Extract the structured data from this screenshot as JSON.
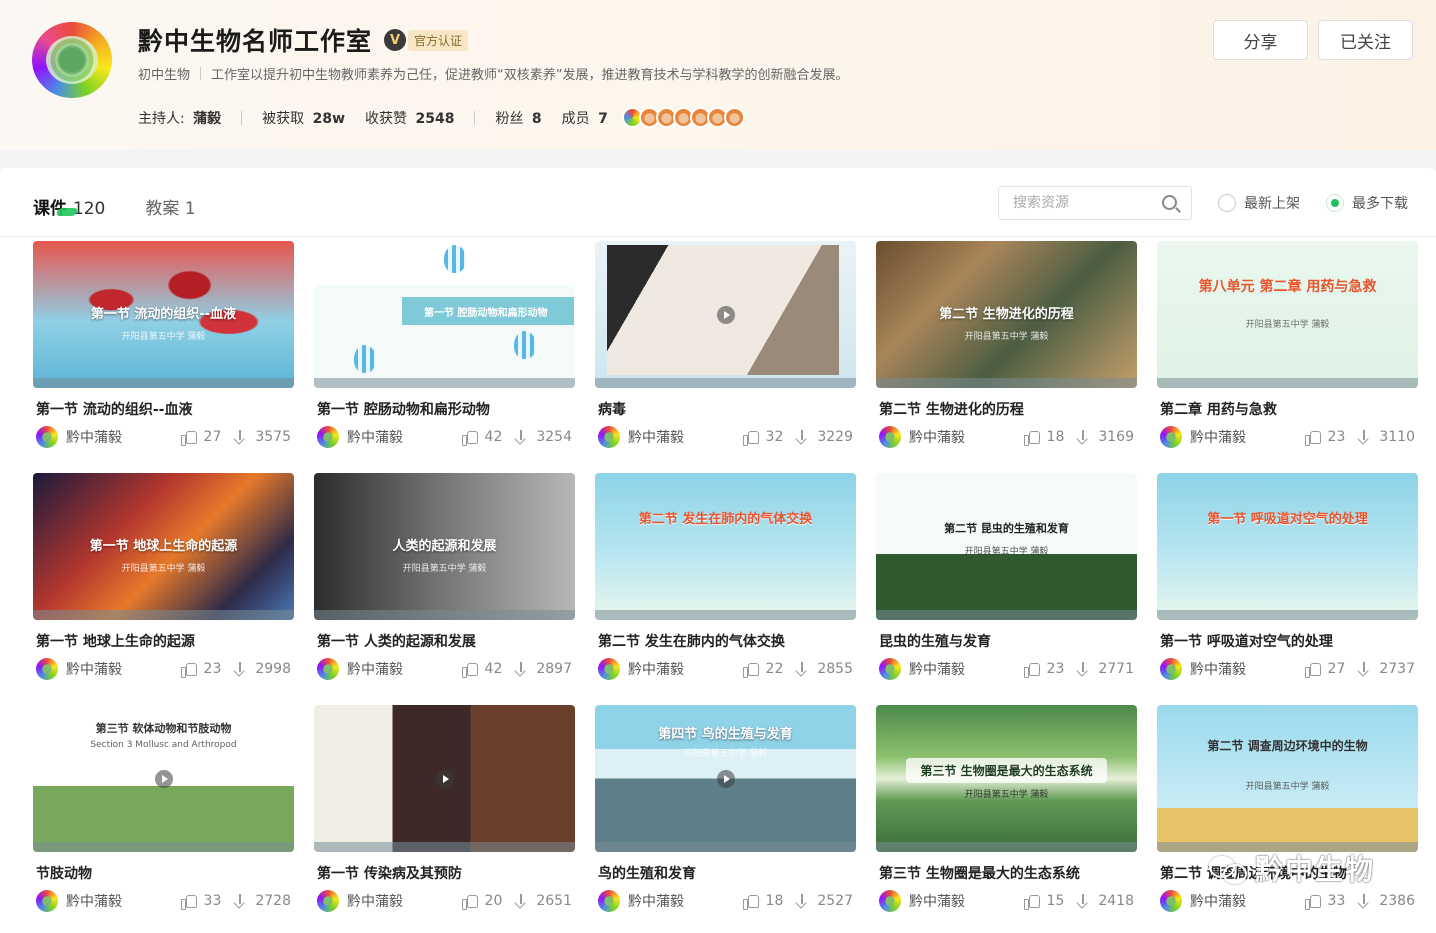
{
  "profile": {
    "title": "黔中生物名师工作室",
    "badge_letter": "V",
    "badge_text": "官方认证",
    "category": "初中生物",
    "description": "工作室以提升初中生物教师素养为己任，促进教师“双核素养”发展，推进教育技术与学科教学的创新融合发展。",
    "host_label": "主持人:",
    "host_name": "蒲毅",
    "obtained_label": "被获取",
    "obtained_value": "28w",
    "likes_label": "收获赞",
    "likes_value": "2548",
    "fans_label": "粉丝",
    "fans_value": "8",
    "members_label": "成员",
    "members_value": "7"
  },
  "actions": {
    "share": "分享",
    "follow": "已关注"
  },
  "tabs": [
    {
      "label": "课件",
      "count": "120"
    },
    {
      "label": "教案",
      "count": "1"
    }
  ],
  "search": {
    "placeholder": "搜索资源",
    "icon": "search-icon"
  },
  "sort": {
    "newest": "最新上架",
    "most": "最多下载",
    "selected": "most"
  },
  "cards": [
    {
      "title": "第一节 流动的组织--血液",
      "thumb_title": "第一节 流动的组织--血液",
      "thumb_sub": "开阳县第五中学 蒲毅",
      "author": "黔中蒲毅",
      "likes": "27",
      "downloads": "3575"
    },
    {
      "title": "第一节 腔肠动物和扁形动物",
      "thumb_title": "第一节 腔肠动物和扁形动物",
      "thumb_sub": "",
      "author": "黔中蒲毅",
      "likes": "42",
      "downloads": "3254"
    },
    {
      "title": "病毒",
      "thumb_title": "",
      "thumb_sub": "",
      "author": "黔中蒲毅",
      "likes": "32",
      "downloads": "3229"
    },
    {
      "title": "第二节 生物进化的历程",
      "thumb_title": "第二节 生物进化的历程",
      "thumb_sub": "开阳县第五中学 蒲毅",
      "author": "黔中蒲毅",
      "likes": "18",
      "downloads": "3169"
    },
    {
      "title": "第二章 用药与急救",
      "thumb_title": "第八单元 第二章 用药与急救",
      "thumb_sub": "开阳县第五中学 蒲毅",
      "author": "黔中蒲毅",
      "likes": "23",
      "downloads": "3110"
    },
    {
      "title": "第一节 地球上生命的起源",
      "thumb_title": "第一节 地球上生命的起源",
      "thumb_sub": "开阳县第五中学 蒲毅",
      "author": "黔中蒲毅",
      "likes": "23",
      "downloads": "2998"
    },
    {
      "title": "第一节 人类的起源和发展",
      "thumb_title": "人类的起源和发展",
      "thumb_sub": "开阳县第五中学 蒲毅",
      "author": "黔中蒲毅",
      "likes": "42",
      "downloads": "2897"
    },
    {
      "title": "第二节 发生在肺内的气体交换",
      "thumb_title": "第二节 发生在肺内的气体交换",
      "thumb_sub": "",
      "author": "黔中蒲毅",
      "likes": "22",
      "downloads": "2855"
    },
    {
      "title": "昆虫的生殖与发育",
      "thumb_title": "第二节 昆虫的生殖和发育",
      "thumb_sub": "开阳县第五中学 蒲毅",
      "author": "黔中蒲毅",
      "likes": "23",
      "downloads": "2771"
    },
    {
      "title": "第一节 呼吸道对空气的处理",
      "thumb_title": "第一节 呼吸道对空气的处理",
      "thumb_sub": "",
      "author": "黔中蒲毅",
      "likes": "27",
      "downloads": "2737"
    },
    {
      "title": "节肢动物",
      "thumb_title": "第三节 软体动物和节肢动物",
      "thumb_sub": "Section 3 Mollusc and Arthropod",
      "author": "黔中蒲毅",
      "likes": "33",
      "downloads": "2728"
    },
    {
      "title": "第一节 传染病及其预防",
      "thumb_title": "",
      "thumb_sub": "",
      "author": "黔中蒲毅",
      "likes": "20",
      "downloads": "2651"
    },
    {
      "title": "鸟的生殖和发育",
      "thumb_title": "第四节 鸟的生殖与发育",
      "thumb_sub": "开阳县第五中学 蒲毅",
      "author": "黔中蒲毅",
      "likes": "18",
      "downloads": "2527"
    },
    {
      "title": "第三节 生物圈是最大的生态系统",
      "thumb_title": "第三节 生物圈是最大的生态系统",
      "thumb_sub": "开阳县第五中学 蒲毅",
      "author": "黔中蒲毅",
      "likes": "15",
      "downloads": "2418"
    },
    {
      "title": "第二节 调查周边环境中的生物",
      "thumb_title": "第二节 调查周边环境中的生物",
      "thumb_sub": "开阳县第五中学 蒲毅",
      "author": "黔中蒲毅",
      "likes": "33",
      "downloads": "2386"
    }
  ],
  "watermark": "黔中生物"
}
